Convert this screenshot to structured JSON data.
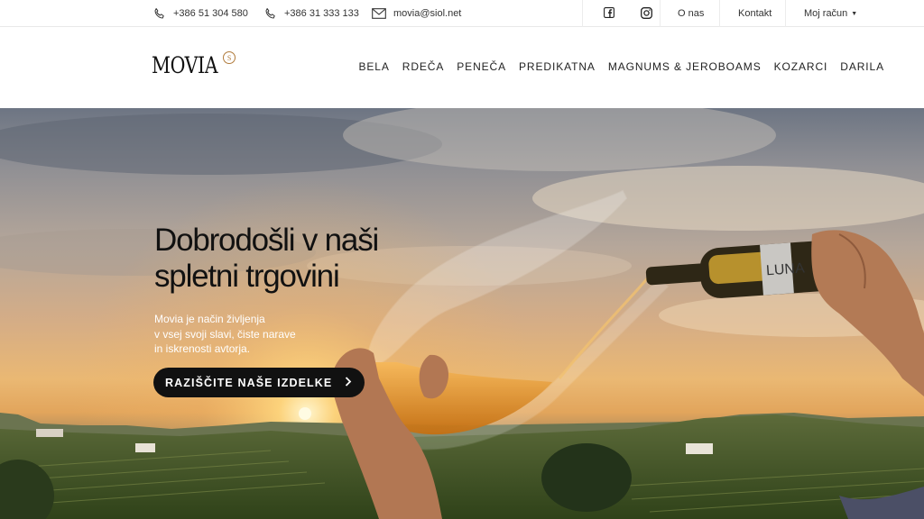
{
  "topbar": {
    "phone1": "+386 51 304 580",
    "phone2": "+386 31 333 133",
    "email": "movia@siol.net",
    "social": [
      {
        "icon": "facebook-icon"
      },
      {
        "icon": "instagram-icon"
      }
    ],
    "about_label": "O nas",
    "contact_label": "Kontakt",
    "account_label": "Moj račun"
  },
  "header": {
    "logo_text": "MOVIA",
    "logo_mark": "S",
    "nav": [
      "BELA",
      "RDEČA",
      "PENEČA",
      "PREDIKATNA",
      "MAGNUMS & JEROBOAMS",
      "KOZARCI",
      "DARILA"
    ]
  },
  "hero": {
    "title": "Dobrodošli v naši spletni trgovini",
    "subtitle": "Movia je način življenja\nv vsej svoji slavi, čiste narave\nin iskrenosti avtorja.",
    "cta_label": "RAZIŠČITE NAŠE IZDELKE",
    "bottle_label": "LUNA"
  },
  "colors": {
    "accent": "#111111",
    "logo_mark": "#b07a3a",
    "topbar_border": "#e9e9e9"
  }
}
